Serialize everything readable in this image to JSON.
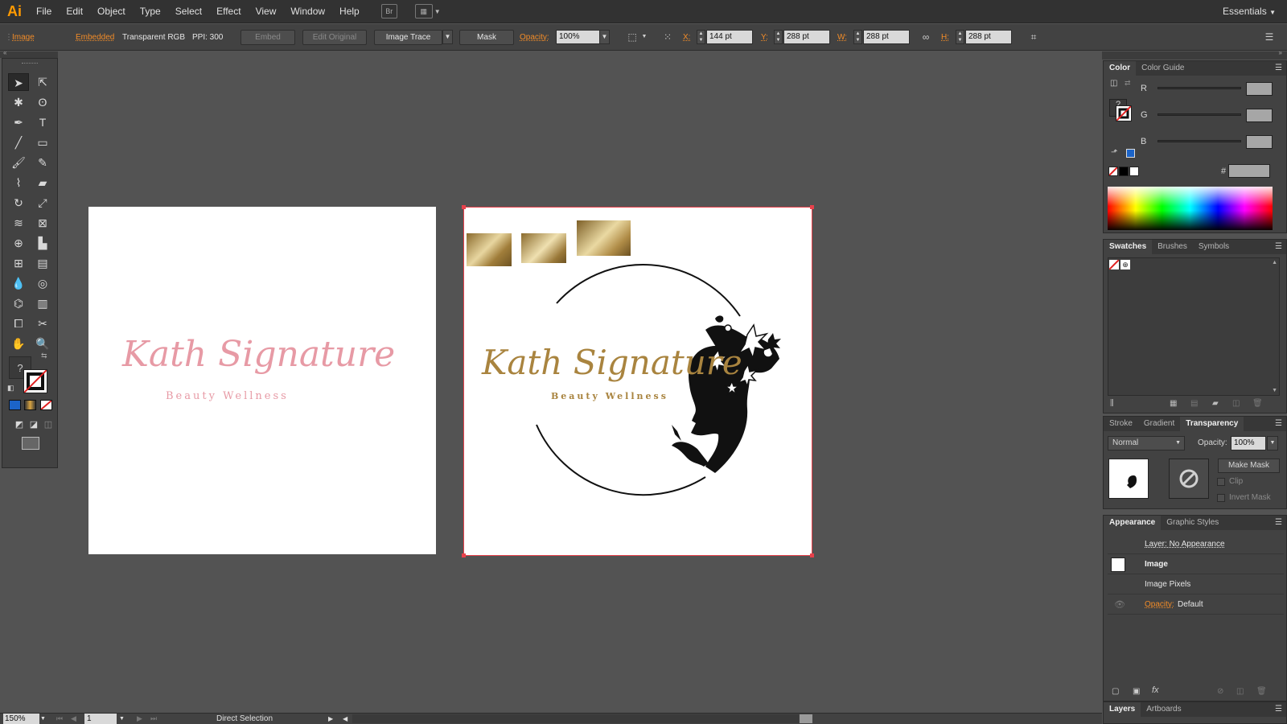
{
  "app": {
    "logo": "Ai"
  },
  "menu": {
    "items": [
      "File",
      "Edit",
      "Object",
      "Type",
      "Select",
      "Effect",
      "View",
      "Window",
      "Help"
    ],
    "bridge_label": "Br",
    "workspace": "Essentials"
  },
  "control": {
    "object_type": "Image",
    "embedded_link": "Embedded",
    "color_mode": "Transparent RGB",
    "ppi": "PPI: 300",
    "embed_button": "Embed",
    "edit_original_button": "Edit Original",
    "image_trace_button": "Image Trace",
    "mask_button": "Mask",
    "opacity_label": "Opacity:",
    "opacity_value": "100%",
    "x_label": "X:",
    "x_value": "144 pt",
    "y_label": "Y:",
    "y_value": "288 pt",
    "w_label": "W:",
    "w_value": "288 pt",
    "h_label": "H:",
    "h_value": "288 pt"
  },
  "artboards": [
    {
      "title": "Kath Signature",
      "subtitle": "Beauty Wellness",
      "color": "#e79aa5"
    },
    {
      "title": "Kath Signature",
      "subtitle": "Beauty Wellness",
      "color": "#a9843f"
    }
  ],
  "color_panel": {
    "tabs": [
      "Color",
      "Color Guide"
    ],
    "channels": [
      "R",
      "G",
      "B"
    ],
    "hex_label": "#"
  },
  "swatches_panel": {
    "tabs": [
      "Swatches",
      "Brushes",
      "Symbols"
    ]
  },
  "transparency_panel": {
    "tabs": [
      "Stroke",
      "Gradient",
      "Transparency"
    ],
    "blend_mode": "Normal",
    "opacity_label": "Opacity:",
    "opacity_value": "100%",
    "make_mask": "Make Mask",
    "clip": "Clip",
    "invert_mask": "Invert Mask"
  },
  "appearance_panel": {
    "tabs": [
      "Appearance",
      "Graphic Styles"
    ],
    "rows": [
      "Layer: No Appearance",
      "Image",
      "Image Pixels"
    ],
    "opacity_label": "Opacity:",
    "opacity_value": "Default"
  },
  "layers_panel": {
    "tabs": [
      "Layers",
      "Artboards"
    ]
  },
  "status": {
    "zoom": "150%",
    "artboard_number": "1",
    "tool_name": "Direct Selection"
  },
  "colors": {
    "accent_orange": "#f28c28",
    "selection_red": "#e8414b",
    "gold": "#a9843f",
    "pink": "#e79aa5"
  }
}
